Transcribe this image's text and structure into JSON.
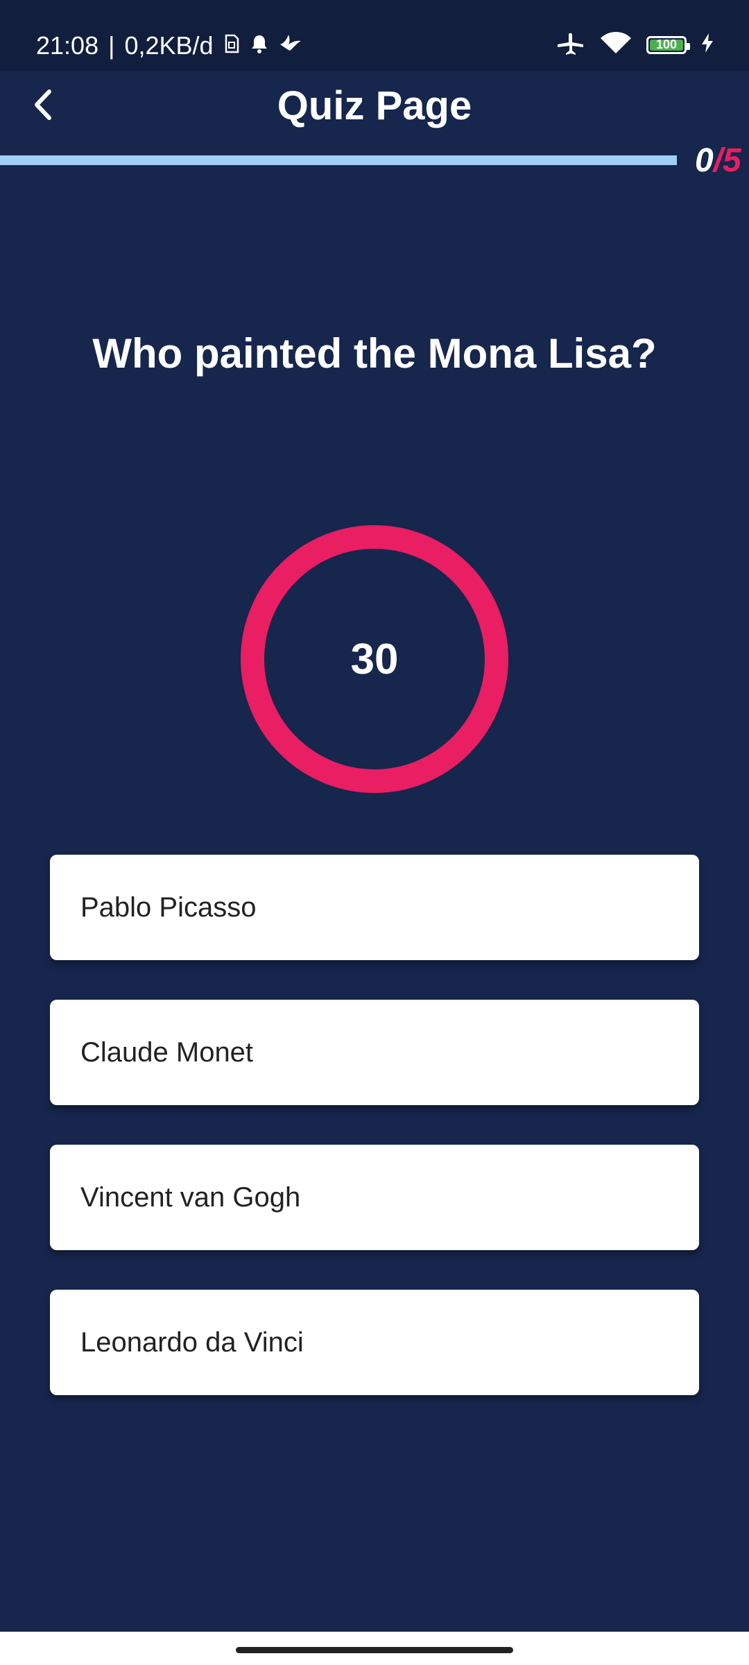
{
  "status_bar": {
    "time": "21:08",
    "separator": "|",
    "data_rate": "0,2KB/d",
    "battery_level": "100",
    "icons": [
      "sim-icon",
      "bell-icon",
      "bird-icon",
      "airplane-icon",
      "wifi-icon",
      "battery-icon",
      "charging-icon"
    ]
  },
  "app_bar": {
    "title": "Quiz Page",
    "back_icon": "chevron-left-icon"
  },
  "progress": {
    "current": "0",
    "total": "/5",
    "fraction": 1.0
  },
  "question": {
    "text": "Who painted the Mona Lisa?"
  },
  "timer": {
    "value": "30",
    "ring_color": "#e91e63"
  },
  "options": [
    {
      "label": "Pablo Picasso"
    },
    {
      "label": "Claude Monet"
    },
    {
      "label": "Vincent van Gogh"
    },
    {
      "label": "Leonardo da Vinci"
    }
  ],
  "colors": {
    "background": "#16264d",
    "status_bar": "#111e3d",
    "progress_fill": "#9fcff7",
    "accent": "#e91e63"
  }
}
